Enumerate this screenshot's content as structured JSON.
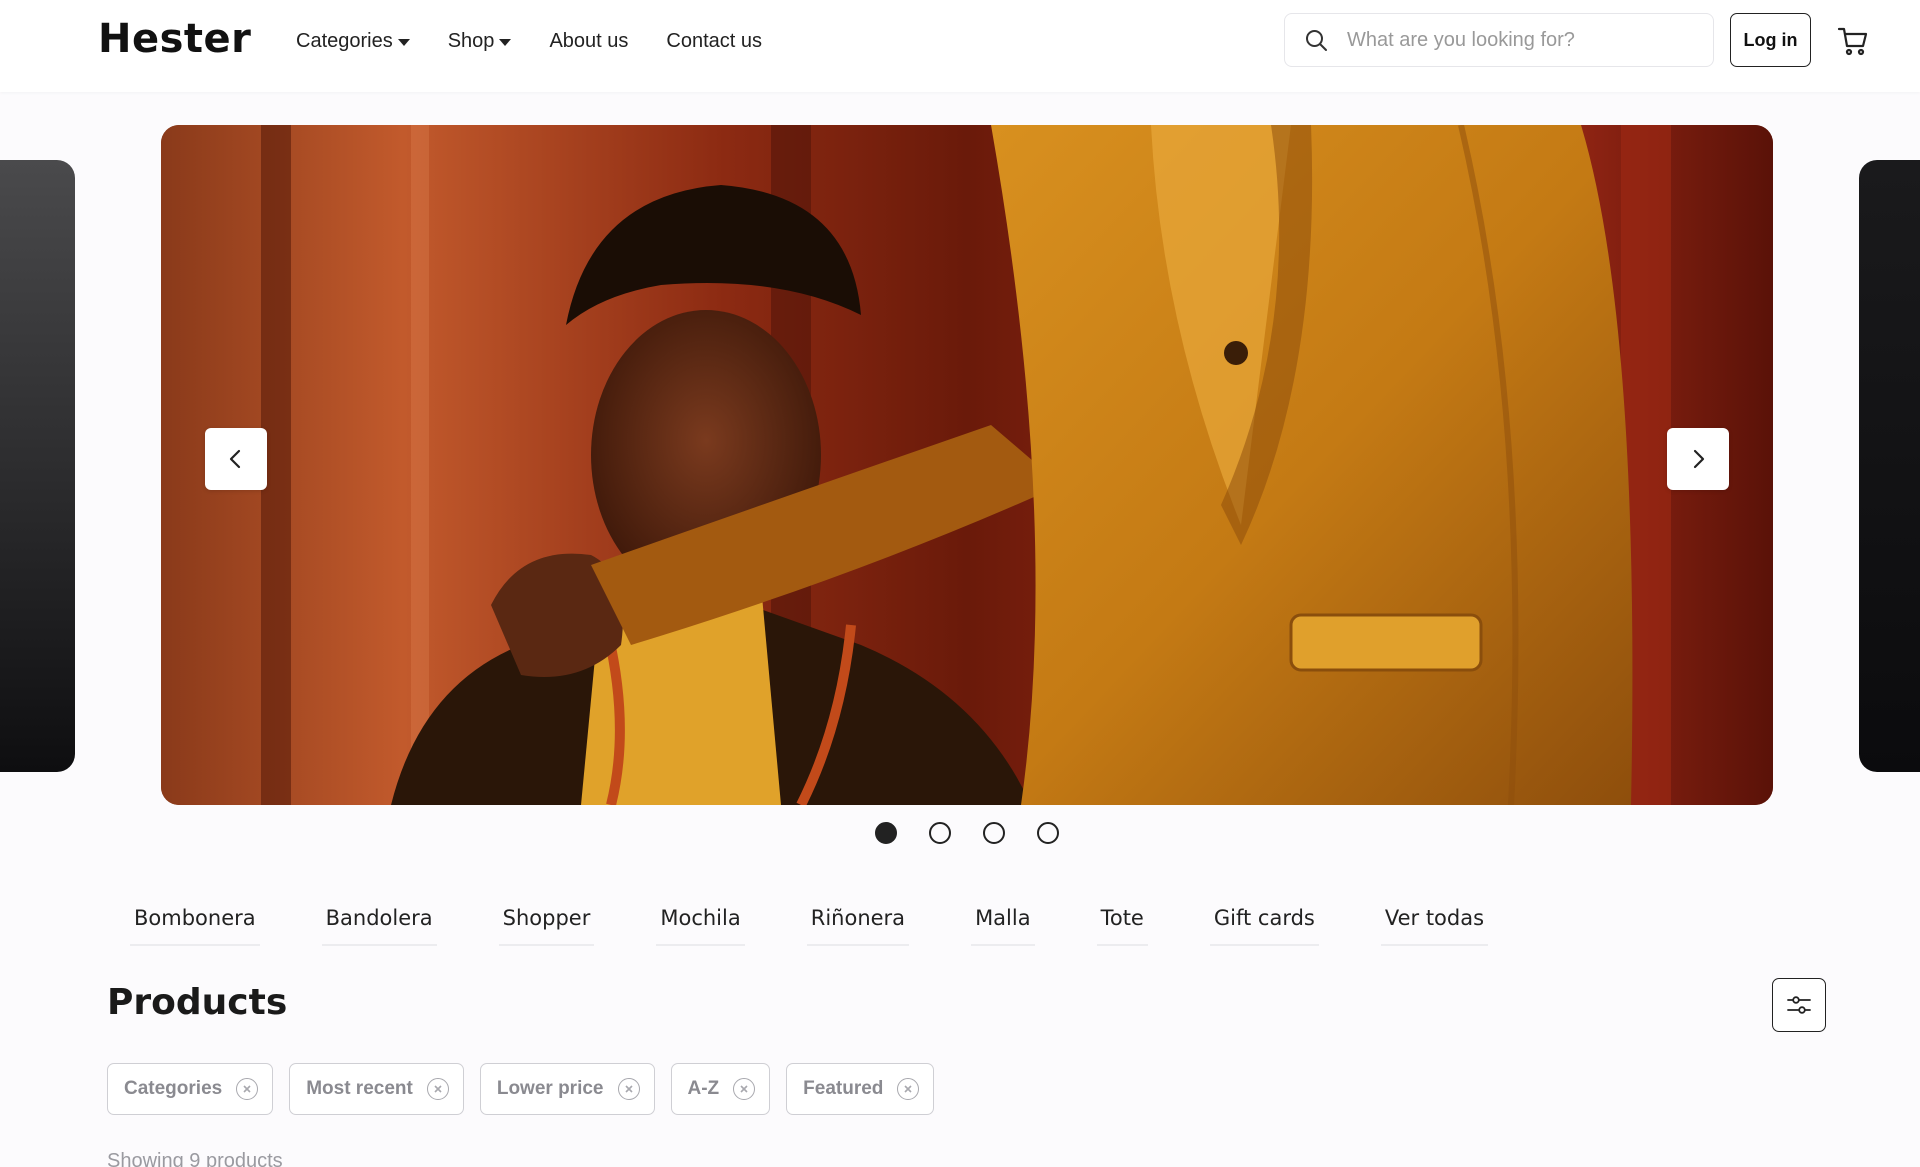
{
  "brand": {
    "logo": "Hester"
  },
  "nav": {
    "items": [
      {
        "label": "Categories",
        "dropdown": true
      },
      {
        "label": "Shop",
        "dropdown": true
      },
      {
        "label": "About us",
        "dropdown": false
      },
      {
        "label": "Contact us",
        "dropdown": false
      }
    ]
  },
  "search": {
    "placeholder": "What are you looking for?",
    "value": "",
    "icon": "search-icon"
  },
  "header": {
    "login_label": "Log in",
    "cart_icon": "cart-icon"
  },
  "carousel": {
    "slide_count": 4,
    "active_index": 0,
    "prev_icon": "chevron-left-icon",
    "next_icon": "chevron-right-icon"
  },
  "categories": [
    "Bombonera",
    "Bandolera",
    "Shopper",
    "Mochila",
    "Riñonera",
    "Malla",
    "Tote",
    "Gift cards",
    "Ver todas"
  ],
  "products": {
    "title": "Products",
    "filter_icon": "sliders-icon",
    "chips": [
      "Categories",
      "Most recent",
      "Lower price",
      "A-Z",
      "Featured"
    ],
    "showing": "Showing 9 products"
  },
  "colors": {
    "accent": "#222222",
    "chip_text": "#8a8a90",
    "background": "#fcfbfd"
  }
}
